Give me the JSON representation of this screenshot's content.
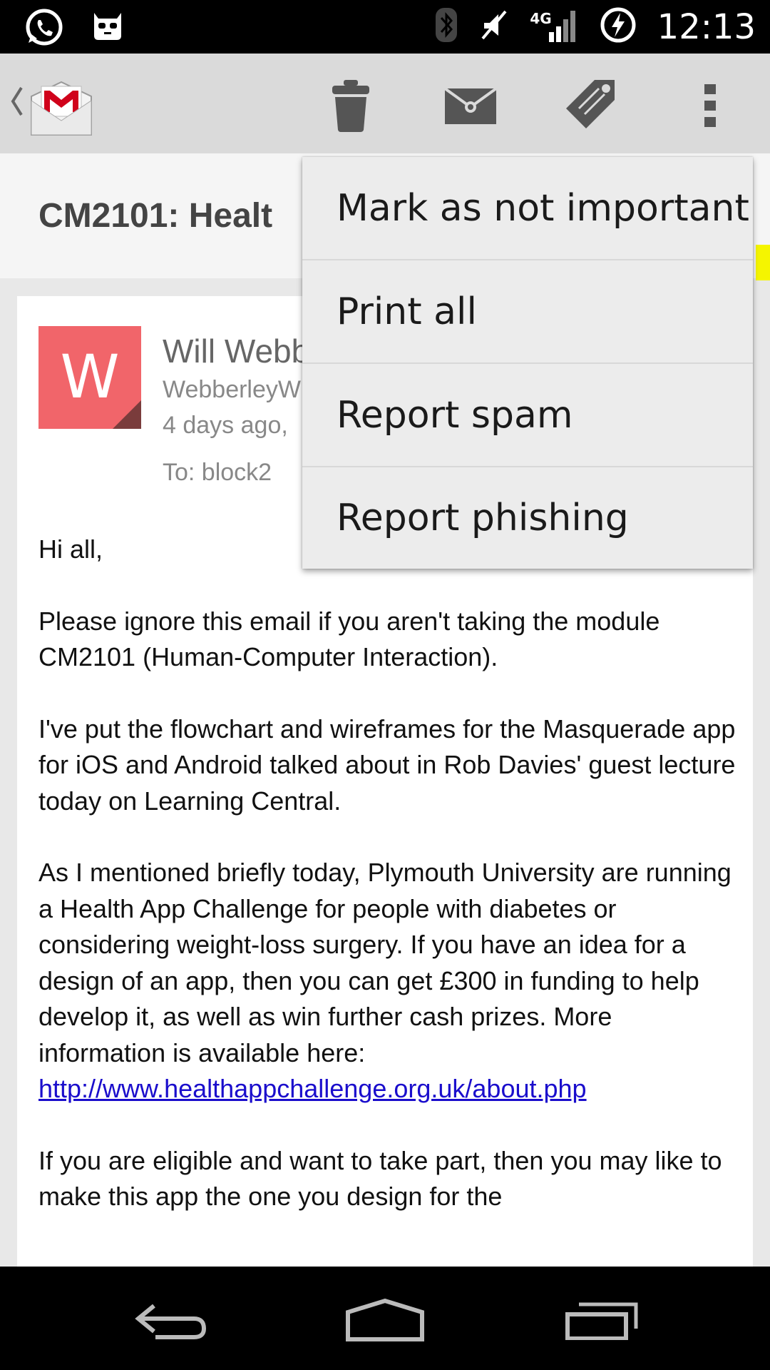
{
  "status_bar": {
    "time": "12:13",
    "network": "4G",
    "left_icons": [
      "whatsapp-icon",
      "cyanogenmod-icon"
    ],
    "right_icons": [
      "bluetooth-icon",
      "vibrate-icon",
      "signal-icon",
      "battery-charging-icon"
    ]
  },
  "action_bar": {
    "icons": [
      "back-chevron-icon",
      "gmail-logo",
      "delete-icon",
      "mark-unread-icon",
      "label-icon",
      "overflow-menu-icon"
    ]
  },
  "conversation": {
    "subject": "CM2101: Healt",
    "important_color": "#f5f500"
  },
  "message": {
    "avatar_letter": "W",
    "avatar_color": "#f1656a",
    "sender_name": "Will Webb",
    "sender_email": "WebberleyW",
    "date": "4 days ago, ",
    "to": "To: block2",
    "body": {
      "p1": "Hi all,",
      "p2": "Please ignore this email if you aren't taking the module CM2101 (Human-Computer Interaction).",
      "p3": "I've put the flowchart and wireframes for the Masquerade app for iOS and Android talked about in Rob Davies' guest lecture today on Learning Central.",
      "p4_text": "As I mentioned briefly today, Plymouth University are running a Health App Challenge for people with diabetes or considering weight-loss surgery. If you have an idea for a design of an app, then you can get £300 in funding to help develop it, as well as win further cash prizes. More information is available here: ",
      "p4_link": "http://www.healthappchallenge.org.uk/about.php",
      "p5": "If you are eligible and want to take part, then you may like to make this app the one you design for the"
    }
  },
  "overflow_menu": {
    "items": [
      "Mark as not important",
      "Print all",
      "Report spam",
      "Report phishing"
    ]
  },
  "nav_bar": {
    "icons": [
      "back-icon",
      "home-icon",
      "recents-icon"
    ]
  }
}
